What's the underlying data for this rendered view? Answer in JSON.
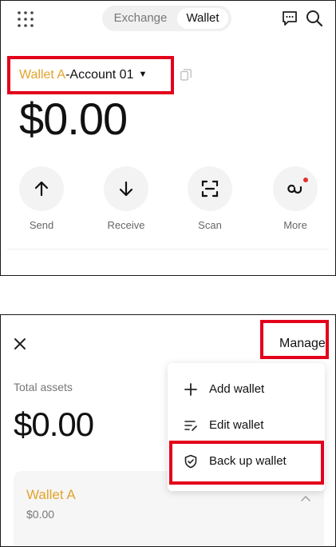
{
  "top": {
    "tabs": {
      "exchange": "Exchange",
      "wallet": "Wallet",
      "active": "Wallet"
    },
    "account": {
      "wallet_name": "Wallet A",
      "separator": "-",
      "account_name": "Account 01"
    },
    "balance": "$0.00",
    "actions": [
      {
        "label": "Send",
        "icon": "arrow-up-icon"
      },
      {
        "label": "Receive",
        "icon": "arrow-down-icon"
      },
      {
        "label": "Scan",
        "icon": "scan-icon"
      },
      {
        "label": "More",
        "icon": "more-icon",
        "has_notification_dot": true
      }
    ]
  },
  "bottom": {
    "manage_label": "Manage",
    "total_label": "Total assets",
    "total_value": "$0.00",
    "menu": [
      {
        "label": "Add wallet",
        "icon": "plus-icon"
      },
      {
        "label": "Edit wallet",
        "icon": "edit-list-icon"
      },
      {
        "label": "Back up wallet",
        "icon": "shield-check-icon"
      }
    ],
    "wallet_card": {
      "name": "Wallet A",
      "amount": "$0.00"
    }
  },
  "colors": {
    "highlight_red": "#e3001b",
    "wallet_gold": "#e2a32b",
    "notification_dot": "#e3302b"
  }
}
